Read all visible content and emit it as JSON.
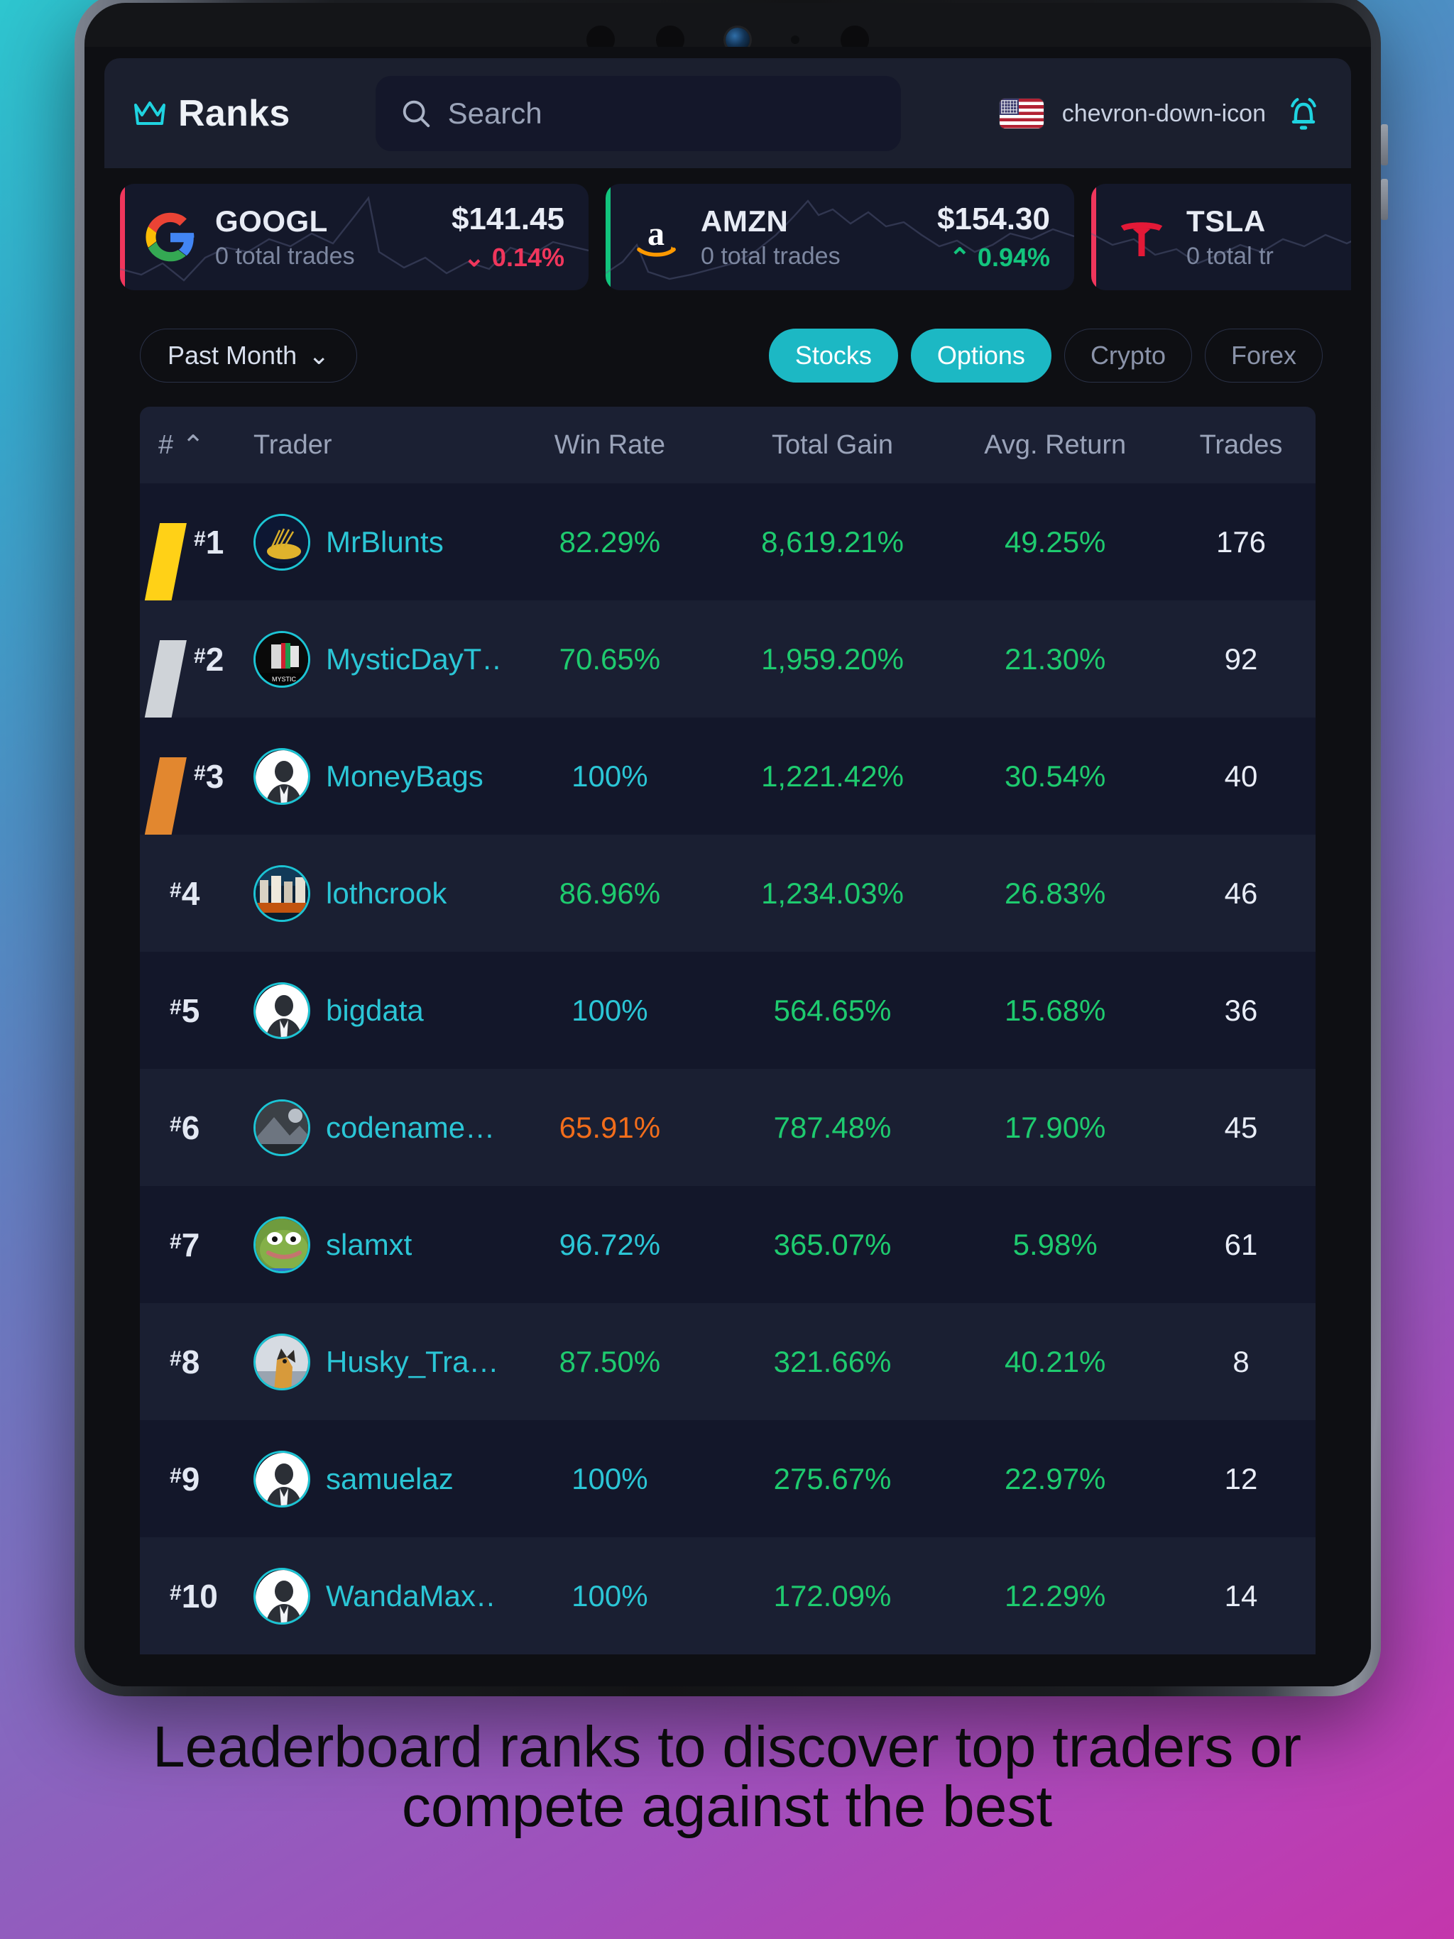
{
  "header": {
    "title": "Ranks",
    "crown_icon": "crown-icon",
    "search_placeholder": "Search",
    "search_value": "",
    "search_icon": "search-icon",
    "flag_icon": "us-flag-icon",
    "chevron_icon": "chevron-down-icon",
    "bell_icon": "notification-bell-icon"
  },
  "tickers": [
    {
      "symbol": "GOOGL",
      "logo": "google-logo",
      "subtitle": "0 total trades",
      "price": "$141.45",
      "change": "0.14%",
      "direction": "down",
      "arrow": "⌄",
      "accent": "#f0365c"
    },
    {
      "symbol": "AMZN",
      "logo": "amazon-logo",
      "subtitle": "0 total trades",
      "price": "$154.30",
      "change": "0.94%",
      "direction": "up",
      "arrow": "⌃",
      "accent": "#12c47d"
    },
    {
      "symbol": "TSLA",
      "logo": "tesla-logo",
      "subtitle": "0 total tr",
      "price": "",
      "change": "",
      "direction": "down",
      "arrow": "",
      "accent": "#f0365c"
    }
  ],
  "filters": {
    "period_label": "Past Month",
    "period_chevron": "⌄",
    "segments": [
      {
        "label": "Stocks",
        "active": true
      },
      {
        "label": "Options",
        "active": true
      },
      {
        "label": "Crypto",
        "active": false
      },
      {
        "label": "Forex",
        "active": false
      }
    ]
  },
  "table": {
    "columns": {
      "rank": "#",
      "rank_sort": "⌃",
      "trader": "Trader",
      "win_rate": "Win Rate",
      "total_gain": "Total Gain",
      "avg_return": "Avg. Return",
      "trades": "Trades"
    },
    "rows": [
      {
        "rank": "1",
        "medal": "gold",
        "name": "MrBlunts",
        "avatar": "mrblunts-avatar",
        "win_rate": "82.29%",
        "win_color": "green",
        "total_gain": "8,619.21%",
        "avg_return": "49.25%",
        "trades": "176"
      },
      {
        "rank": "2",
        "medal": "silver",
        "name": "MysticDayT…",
        "avatar": "mysticdayt-avatar",
        "win_rate": "70.65%",
        "win_color": "green",
        "total_gain": "1,959.20%",
        "avg_return": "21.30%",
        "trades": "92"
      },
      {
        "rank": "3",
        "medal": "bronze",
        "name": "MoneyBags",
        "avatar": "default-avatar",
        "win_rate": "100%",
        "win_color": "teal",
        "total_gain": "1,221.42%",
        "avg_return": "30.54%",
        "trades": "40"
      },
      {
        "rank": "4",
        "medal": "",
        "name": "lothcrook",
        "avatar": "lothcrook-avatar",
        "win_rate": "86.96%",
        "win_color": "green",
        "total_gain": "1,234.03%",
        "avg_return": "26.83%",
        "trades": "46"
      },
      {
        "rank": "5",
        "medal": "",
        "name": "bigdata",
        "avatar": "default-avatar",
        "win_rate": "100%",
        "win_color": "teal",
        "total_gain": "564.65%",
        "avg_return": "15.68%",
        "trades": "36"
      },
      {
        "rank": "6",
        "medal": "",
        "name": "codename…",
        "avatar": "codename-avatar",
        "win_rate": "65.91%",
        "win_color": "orange",
        "total_gain": "787.48%",
        "avg_return": "17.90%",
        "trades": "45"
      },
      {
        "rank": "7",
        "medal": "",
        "name": "slamxt",
        "avatar": "slamxt-avatar",
        "win_rate": "96.72%",
        "win_color": "teal",
        "total_gain": "365.07%",
        "avg_return": "5.98%",
        "trades": "61"
      },
      {
        "rank": "8",
        "medal": "",
        "name": "Husky_Tra…",
        "avatar": "husky-avatar",
        "win_rate": "87.50%",
        "win_color": "green",
        "total_gain": "321.66%",
        "avg_return": "40.21%",
        "trades": "8"
      },
      {
        "rank": "9",
        "medal": "",
        "name": "samuelaz",
        "avatar": "default-avatar",
        "win_rate": "100%",
        "win_color": "teal",
        "total_gain": "275.67%",
        "avg_return": "22.97%",
        "trades": "12"
      },
      {
        "rank": "10",
        "medal": "",
        "name": "WandaMax…",
        "avatar": "default-avatar",
        "win_rate": "100%",
        "win_color": "teal",
        "total_gain": "172.09%",
        "avg_return": "12.29%",
        "trades": "14"
      }
    ]
  },
  "caption": "Leaderboard ranks to discover top traders or compete against the best",
  "colors": {
    "accent_teal": "#1cb8c4",
    "green": "#1ecb6f",
    "orange": "#f26d1b",
    "red": "#f0365c",
    "gold": "#ffd117",
    "silver": "#cfd3d8",
    "bronze": "#e2872f"
  }
}
